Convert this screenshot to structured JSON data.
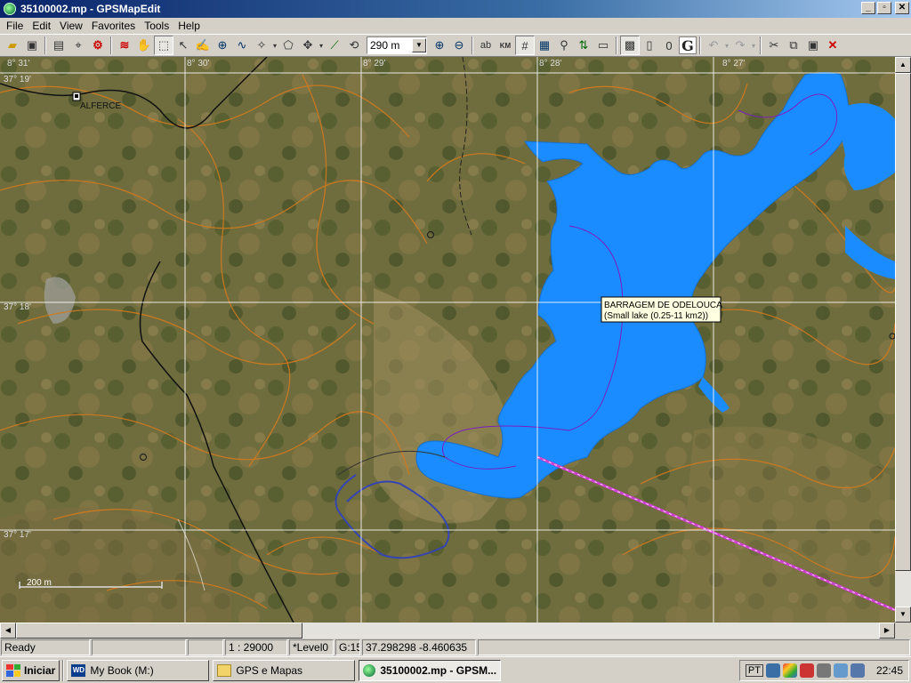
{
  "window": {
    "title": "35100002.mp - GPSMapEdit"
  },
  "menu": [
    "File",
    "Edit",
    "View",
    "Favorites",
    "Tools",
    "Help"
  ],
  "toolbar": {
    "scale_value": "290 m"
  },
  "map": {
    "place_label": "ALFERCE",
    "lake_tooltip": {
      "name": "BARRAGEM DE ODELOUCA",
      "type": "(Small lake (0.25-11 km2))"
    },
    "scale_bar_label": "200 m",
    "grid_labels": {
      "top": [
        "8° 31'",
        "8° 30'",
        "8° 29'",
        "8° 28'",
        "8° 27'"
      ],
      "left": [
        "37° 19'",
        "37° 18'",
        "37° 17'"
      ]
    },
    "colors": {
      "water": "#1a8cff",
      "contour": "#d07a1e",
      "route": "#d040d0"
    }
  },
  "status": {
    "ready": "Ready",
    "scale": "1 : 29000",
    "level": "*Level0",
    "grid": "G:15",
    "coords": "37.298298 -8.460635"
  },
  "taskbar": {
    "start": "Iniciar",
    "items": [
      {
        "label": "My Book (M:)",
        "icon": "drive-icon",
        "active": false
      },
      {
        "label": "GPS e Mapas",
        "icon": "folder-icon",
        "active": false
      },
      {
        "label": "35100002.mp - GPSM...",
        "icon": "globe-icon",
        "active": true
      }
    ],
    "language": "PT",
    "clock": "22:45"
  }
}
